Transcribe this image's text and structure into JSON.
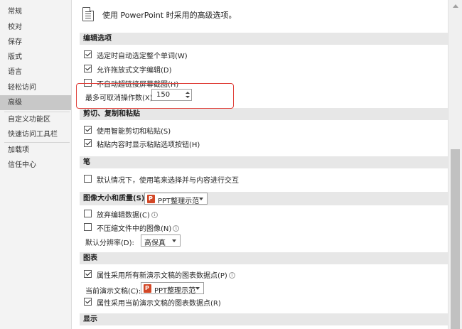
{
  "sidebar": {
    "items": [
      {
        "label": "常规"
      },
      {
        "label": "校对"
      },
      {
        "label": "保存"
      },
      {
        "label": "版式"
      },
      {
        "label": "语言"
      },
      {
        "label": "轻松访问"
      },
      {
        "label": "高级",
        "active": true
      },
      {
        "label": "自定义功能区"
      },
      {
        "label": "快速访问工具栏"
      },
      {
        "label": "加载项"
      },
      {
        "label": "信任中心"
      }
    ]
  },
  "header": {
    "title": "使用 PowerPoint 时采用的高级选项。"
  },
  "sections": {
    "editing": {
      "title": "编辑选项",
      "auto_select_word": "选定时自动选定整个单词(W)",
      "drag_drop": "允许拖放式文字编辑(D)",
      "hyperlink_screenshot": "不自动超链接屏幕截图(H)",
      "max_undo_label": "最多可取消操作数(X):",
      "max_undo_value": "150"
    },
    "clipboard": {
      "title": "剪切、复制和粘贴",
      "smart_cut": "使用智能剪切和粘贴(S)",
      "paste_options": "粘贴内容时显示粘贴选项按钮(H)"
    },
    "pen": {
      "title": "笔",
      "pen_select": "默认情况下，使用笔来选择并与内容进行交互"
    },
    "image": {
      "title": "图像大小和质量(S)",
      "doc_name": "PPT整理示范",
      "discard_edit": "放弃编辑数据(C)",
      "no_compress": "不压缩文件中的图像(N)",
      "resolution_label": "默认分辨率(D):",
      "resolution_value": "高保真"
    },
    "chart": {
      "title": "图表",
      "props_all": "属性采用所有新演示文稿的图表数据点(P)",
      "current_doc_label": "当前演示文稿(C):",
      "current_doc_value": "PPT整理示范",
      "props_current": "属性采用当前演示文稿的图表数据点(R)"
    },
    "display": {
      "title": "显示"
    }
  },
  "info_glyph": "i",
  "colors": {
    "sidebar_bg": "#f3f3f3",
    "active_item_bg": "#c8c8c8",
    "section_bg": "#e7e7e7",
    "highlight": "#e0413b",
    "ppt_icon": "#d24726"
  }
}
